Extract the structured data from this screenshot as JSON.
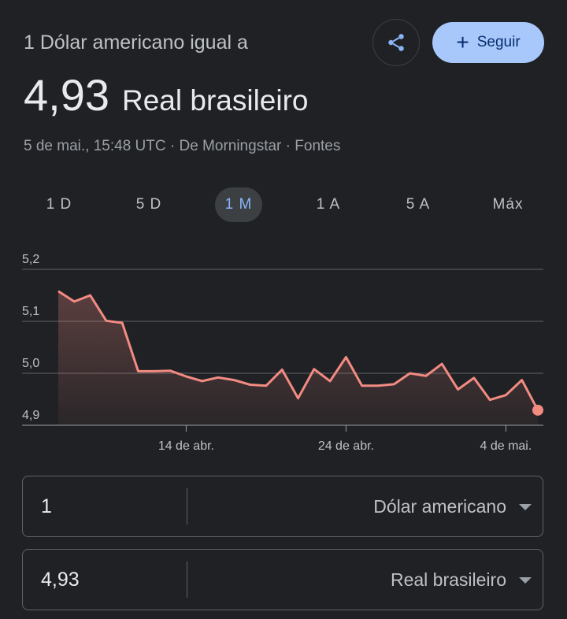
{
  "header": {
    "title": "1 Dólar americano igual a",
    "follow_label": "Seguir",
    "share_icon": "share-icon",
    "follow_icon": "plus-icon"
  },
  "rate": {
    "value": "4,93",
    "currency": "Real brasileiro"
  },
  "meta": {
    "timestamp": "5 de mai., 15:48 UTC",
    "source": "De Morningstar",
    "sources_link": "Fontes",
    "separator": " · "
  },
  "tabs": [
    {
      "label": "1 D",
      "active": false
    },
    {
      "label": "5 D",
      "active": false
    },
    {
      "label": "1 M",
      "active": true
    },
    {
      "label": "1 A",
      "active": false
    },
    {
      "label": "5 A",
      "active": false
    },
    {
      "label": "Máx",
      "active": false
    }
  ],
  "chart_data": {
    "type": "area",
    "y_ticks": [
      "5,2",
      "5,1",
      "5,0",
      "4,9"
    ],
    "x_ticks": [
      "14 de abr.",
      "24 de abr.",
      "4 de mai."
    ],
    "ylim": [
      4.9,
      5.2
    ],
    "grid": true,
    "line_color": "#f28b82",
    "series": [
      {
        "values": [
          5.158,
          5.138,
          5.15,
          5.101,
          5.097,
          5.004,
          5.004,
          5.005,
          4.994,
          4.985,
          4.992,
          4.987,
          4.978,
          4.976,
          5.007,
          4.952,
          5.008,
          4.985,
          5.031,
          4.976,
          4.976,
          4.979,
          5.0,
          4.995,
          5.018,
          4.969,
          4.991,
          4.949,
          4.958,
          4.987,
          4.929
        ]
      }
    ]
  },
  "converter": {
    "from": {
      "amount": "1",
      "currency": "Dólar americano"
    },
    "to": {
      "amount": "4,93",
      "currency": "Real brasileiro"
    }
  },
  "colors": {
    "background": "#202124",
    "accent": "#a8c7fa",
    "active_tab": "#8ab4f8"
  }
}
